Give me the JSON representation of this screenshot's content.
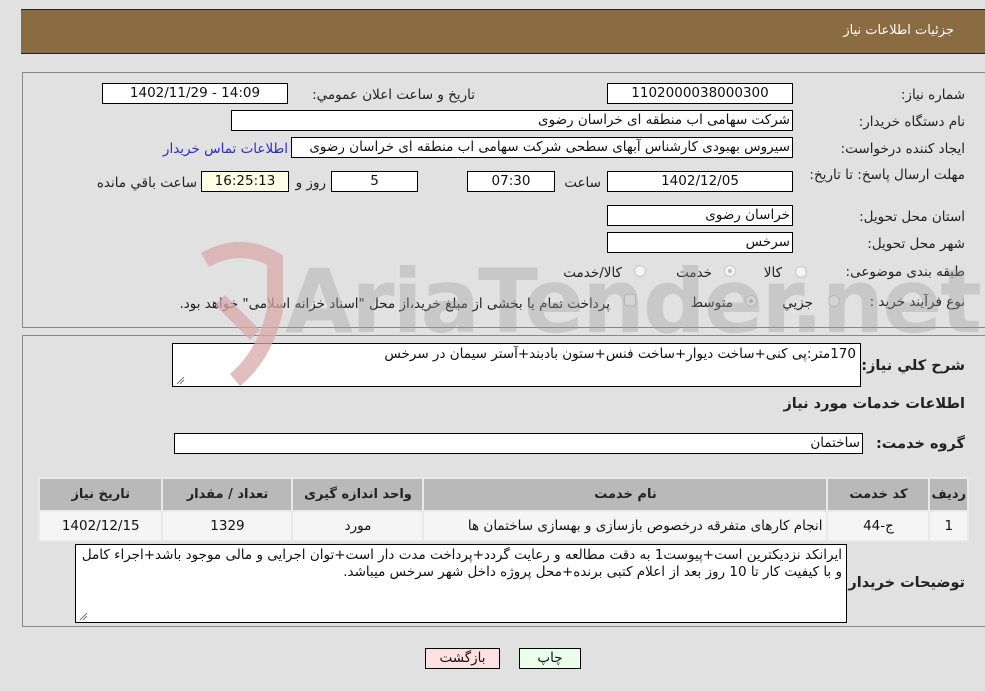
{
  "header": {
    "title": "جزئیات اطلاعات نیاز"
  },
  "form": {
    "need_number_label": "شماره نیاز:",
    "need_number": "1102000038000300",
    "announce_label": "تاریخ و ساعت اعلان عمومي:",
    "announce_value": "1402/11/29 - 14:09",
    "buyer_org_label": "نام دستگاه خریدار:",
    "buyer_org": "شرکت سهامی اب منطقه ای خراسان رضوی",
    "creator_label": "ایجاد کننده درخواست:",
    "creator": "سیروس  بهبودی کارشناس آبهای سطحی شرکت سهامی اب منطقه ای خراسان رضوی",
    "contact_link": "اطلاعات تماس خریدار",
    "deadline_label": "مهلت ارسال پاسخ: تا تاریخ:",
    "deadline_date": "1402/12/05",
    "time_label": "ساعت",
    "deadline_time": "07:30",
    "days_value": "5",
    "days_label": "روز و",
    "remaining_time": "16:25:13",
    "remaining_label": "ساعت باقي مانده",
    "province_label": "استان محل تحویل:",
    "province": "خراسان رضوی",
    "city_label": "شهر محل تحویل:",
    "city": "سرخس",
    "category_label": "طبقه بندی موضوعی:",
    "category_options": [
      "کالا",
      "خدمت",
      "کالا/خدمت"
    ],
    "category_selected": "خدمت",
    "process_label": "نوع فرآیند خرید :",
    "process_options": [
      "جزيي",
      "متوسط"
    ],
    "process_selected": "متوسط",
    "treasury_note": "پرداخت تمام یا بخشی از مبلغ خرید،از محل \"اسناد خزانه اسلامی\" خواهد بود."
  },
  "details": {
    "description_label": "شرح کلي نیاز:",
    "description": "170متر:پی کنی+ساخت دیوار+ساخت فنس+ستون بادبند+آستر سیمان در سرخس",
    "services_heading": "اطلاعات خدمات مورد نیاز",
    "service_group_label": "گروه خدمت:",
    "service_group": "ساختمان",
    "table": {
      "headers": [
        "ردیف",
        "کد خدمت",
        "نام خدمت",
        "واحد اندازه گیری",
        "تعداد / مقدار",
        "تاریخ نیاز"
      ],
      "rows": [
        [
          "1",
          "ج-44",
          "انجام کارهای متفرقه درخصوص بازسازی و بهسازی ساختمان ها",
          "مورد",
          "1329",
          "1402/12/15"
        ]
      ]
    },
    "buyer_notes_label": "توضیحات خریدار:",
    "buyer_notes": "ایرانکد نزدیکترین است+پیوست1 به دقت مطالعه و رعایت گردد+پرداخت مدت دار است+توان اجرایی و مالی موجود باشد+اجراء کامل و با کیفیت کار تا 10 روز بعد از اعلام کتبی برنده+محل پروژه داخل شهر سرخس میباشد."
  },
  "buttons": {
    "print": "چاپ",
    "back": "بازگشت"
  },
  "watermark": {
    "text": "AriaTender.net"
  }
}
